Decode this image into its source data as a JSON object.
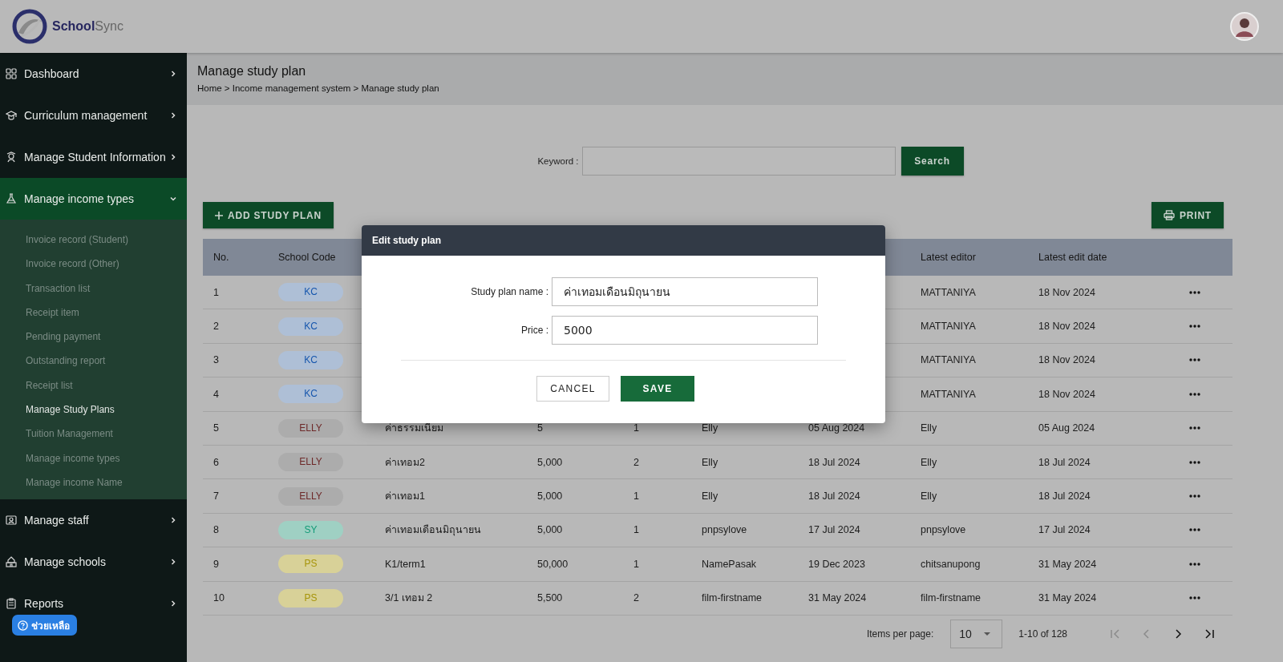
{
  "app": {
    "logo_primary": "School",
    "logo_secondary": "Sync"
  },
  "sidebar": {
    "items": [
      {
        "label": "Dashboard",
        "selected": false,
        "expanded": false
      },
      {
        "label": "Curriculum management",
        "selected": false,
        "expanded": false
      },
      {
        "label": "Manage Student Information",
        "selected": false,
        "expanded": false
      },
      {
        "label": "Manage income types",
        "selected": true,
        "expanded": true,
        "children": [
          {
            "label": "Invoice record (Student)",
            "selected": false
          },
          {
            "label": "Invoice record (Other)",
            "selected": false
          },
          {
            "label": "Transaction list",
            "selected": false
          },
          {
            "label": "Receipt item",
            "selected": false
          },
          {
            "label": "Pending payment",
            "selected": false
          },
          {
            "label": "Outstanding report",
            "selected": false
          },
          {
            "label": "Receipt list",
            "selected": false
          },
          {
            "label": "Manage Study Plans",
            "selected": true
          },
          {
            "label": "Tuition Management",
            "selected": false
          },
          {
            "label": "Manage income types",
            "selected": false
          },
          {
            "label": "Manage income Name",
            "selected": false
          }
        ]
      },
      {
        "label": "Manage staff",
        "selected": false,
        "expanded": false
      },
      {
        "label": "Manage schools",
        "selected": false,
        "expanded": false
      },
      {
        "label": "Reports",
        "selected": false,
        "expanded": false
      }
    ],
    "help_button": "ช่วยเหลือ"
  },
  "page_header": {
    "title": "Manage study plan",
    "breadcrumb": "Home > Income management system > Manage study plan"
  },
  "search": {
    "label": "Keyword :",
    "button": "Search"
  },
  "actions": {
    "add_button": "ADD STUDY PLAN",
    "print_button": "PRINT"
  },
  "table": {
    "columns": [
      "No.",
      "School Code",
      null,
      null,
      null,
      null,
      null,
      "Latest editor",
      "Latest edit date"
    ],
    "rows": [
      {
        "cells": [
          "1",
          {
            "label": "KC",
            "color": "#aebfd6"
          },
          null,
          null,
          null,
          null,
          null,
          "MATTANIYA",
          "18 Nov 2024"
        ]
      },
      {
        "cells": [
          "2",
          {
            "label": "KC",
            "color": "#aebfd6"
          },
          null,
          null,
          null,
          null,
          null,
          "MATTANIYA",
          "18 Nov 2024"
        ]
      },
      {
        "cells": [
          "3",
          {
            "label": "KC",
            "color": "#aebfd6"
          },
          null,
          null,
          null,
          null,
          null,
          "MATTANIYA",
          "18 Nov 2024"
        ]
      },
      {
        "cells": [
          "4",
          {
            "label": "KC",
            "color": "#aebfd6"
          },
          null,
          null,
          null,
          null,
          null,
          "MATTANIYA",
          "18 Nov 2024"
        ]
      },
      {
        "cells": [
          "5",
          {
            "label": "ELLY",
            "color": "#acacac"
          },
          "ค่าธรรมเนียม",
          "5",
          "1",
          "Elly",
          "05 Aug 2024",
          "Elly",
          "05 Aug 2024"
        ]
      },
      {
        "cells": [
          "6",
          {
            "label": "ELLY",
            "color": "#acacac"
          },
          "ค่าเทอม2",
          "5,000",
          "2",
          "Elly",
          "18 Jul 2024",
          "Elly",
          "18 Jul 2024"
        ]
      },
      {
        "cells": [
          "7",
          {
            "label": "ELLY",
            "color": "#acacac"
          },
          "ค่าเทอม1",
          "5,000",
          "1",
          "Elly",
          "18 Jul 2024",
          "Elly",
          "18 Jul 2024"
        ]
      },
      {
        "cells": [
          "8",
          {
            "label": "SY",
            "color": "#9fd0c3"
          },
          "ค่าเทอมเดือนมิถุนายน",
          "5,000",
          "1",
          "pnpsylove",
          "17 Jul 2024",
          "pnpsylove",
          "17 Jul 2024"
        ]
      },
      {
        "cells": [
          "9",
          {
            "label": "PS",
            "color": "#d8d198"
          },
          "K1/term1",
          "50,000",
          "1",
          "NamePasak",
          "19 Dec 2023",
          "chitsanupong",
          "31 May 2024"
        ]
      },
      {
        "cells": [
          "10",
          {
            "label": "PS",
            "color": "#d8d198"
          },
          "3/1 เทอม 2",
          "5,500",
          "2",
          "film-firstname",
          "31 May 2024",
          "film-firstname",
          "31 May 2024"
        ]
      }
    ]
  },
  "paginator": {
    "label": "Items per page:",
    "page_size": "10",
    "range": "1-10 of 128"
  },
  "dialog": {
    "title": "Edit study plan",
    "fields": [
      {
        "label": "Study plan name :",
        "value": "ค่าเทอมเดือนมิถุนายน"
      },
      {
        "label": "Price :",
        "value": "5000"
      }
    ],
    "buttons": [
      {
        "label": "CANCEL",
        "kind": "secondary"
      },
      {
        "label": "SAVE",
        "kind": "primary"
      }
    ]
  }
}
